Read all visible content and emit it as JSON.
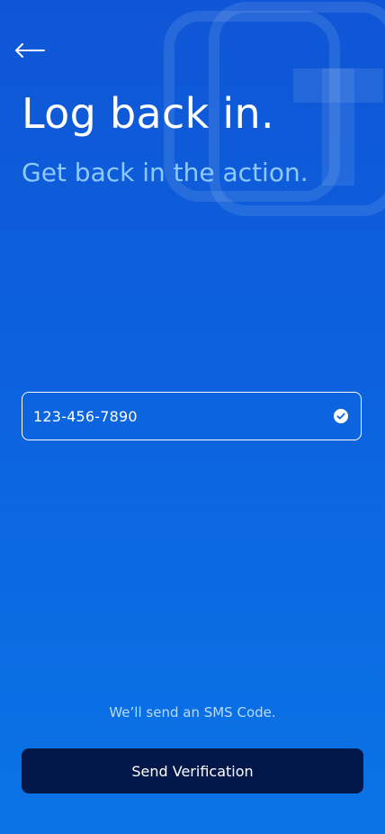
{
  "header": {
    "back_icon": "arrow-left-icon"
  },
  "hero": {
    "title": "Log back in.",
    "subtitle": "Get back in the action."
  },
  "phone": {
    "value": "123-456-7890",
    "status_icon": "check-circle-icon"
  },
  "footer": {
    "note": "We’ll send an SMS Code.",
    "button_label": "Send Verification"
  },
  "colors": {
    "background_top": "#0f56d6",
    "background_bottom": "#0a74e6",
    "subtitle": "#8ec9ff",
    "button": "#03184a",
    "check": "#ffffff"
  }
}
